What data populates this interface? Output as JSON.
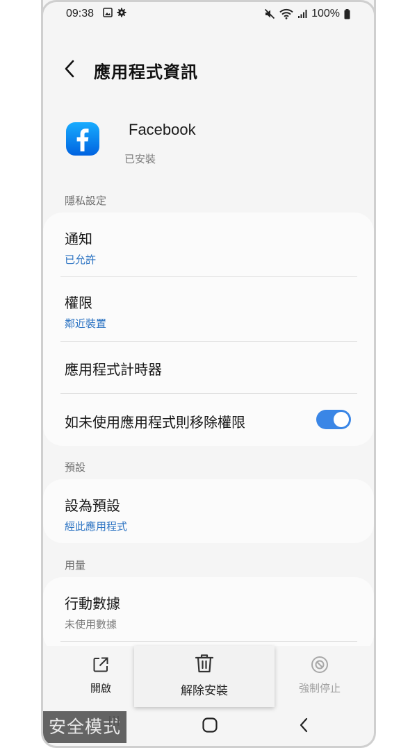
{
  "status_bar": {
    "time": "09:38",
    "battery": "100%"
  },
  "header": {
    "title": "應用程式資訊"
  },
  "app": {
    "name": "Facebook",
    "status": "已安裝",
    "brand_color": "#1877F2"
  },
  "sections": {
    "privacy_label": "隱私設定",
    "defaults_label": "預設",
    "usage_label": "用量"
  },
  "privacy_rows": {
    "notifications_title": "通知",
    "notifications_value": "已允許",
    "permissions_title": "權限",
    "permissions_value": "鄰近裝置",
    "timer_title": "應用程式計時器",
    "remove_permissions_title": "如未使用應用程式則移除權限",
    "remove_permissions_enabled": true
  },
  "defaults_rows": {
    "set_default_title": "設為預設",
    "set_default_value": "經此應用程式"
  },
  "usage_rows": {
    "mobile_data_title": "行動數據",
    "mobile_data_value": "未使用數據"
  },
  "bottom_actions": {
    "open_label": "開啟",
    "uninstall_label": "解除安裝",
    "force_stop_label": "強制停止"
  },
  "nav": {
    "safe_mode_label": "安全模式"
  },
  "colors": {
    "accent": "#2a72c2",
    "toggle_on": "#3a86e6"
  }
}
